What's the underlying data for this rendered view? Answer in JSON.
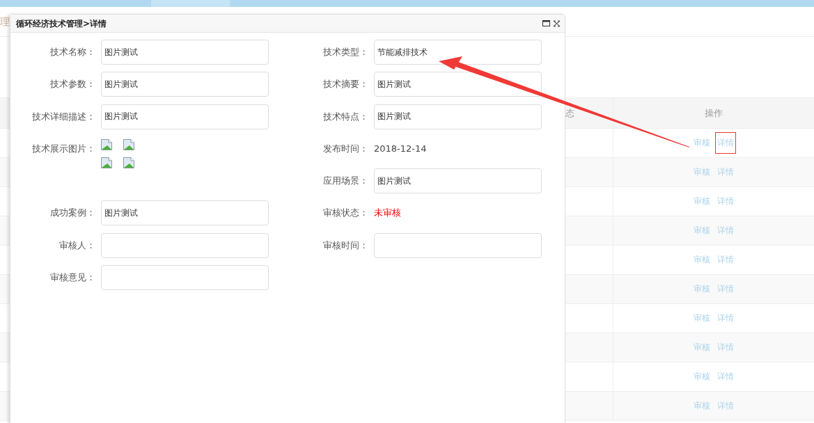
{
  "page": {
    "title_fragment": "理"
  },
  "table": {
    "columns": [
      "态",
      "操作"
    ],
    "rows": [
      {
        "actions": [
          {
            "label": "审核",
            "marked": false
          },
          {
            "label": "详情",
            "marked": true
          }
        ]
      },
      {
        "actions": [
          {
            "label": "审核",
            "marked": false
          },
          {
            "label": "详情",
            "marked": false
          }
        ]
      },
      {
        "actions": [
          {
            "label": "审核",
            "marked": false
          },
          {
            "label": "详情",
            "marked": false
          }
        ]
      },
      {
        "actions": [
          {
            "label": "审核",
            "marked": false
          },
          {
            "label": "详情",
            "marked": false
          }
        ]
      },
      {
        "actions": [
          {
            "label": "审核",
            "marked": false
          },
          {
            "label": "详情",
            "marked": false
          }
        ]
      },
      {
        "actions": [
          {
            "label": "审核",
            "marked": false
          },
          {
            "label": "详情",
            "marked": false
          }
        ]
      },
      {
        "actions": [
          {
            "label": "审核",
            "marked": false
          },
          {
            "label": "详情",
            "marked": false
          }
        ]
      },
      {
        "actions": [
          {
            "label": "审核",
            "marked": false
          },
          {
            "label": "详情",
            "marked": false
          }
        ]
      },
      {
        "actions": [
          {
            "label": "审核",
            "marked": false
          },
          {
            "label": "详情",
            "marked": false
          }
        ]
      },
      {
        "actions": [
          {
            "label": "审核",
            "marked": false
          },
          {
            "label": "详情",
            "marked": false
          }
        ]
      }
    ]
  },
  "dialog": {
    "title": "循环经济技术管理>详情",
    "left_fields": [
      {
        "kind": "input",
        "label": "技术名称：",
        "value": "图片测试"
      },
      {
        "kind": "input",
        "label": "技术参数：",
        "value": "图片测试"
      },
      {
        "kind": "input",
        "label": "技术详细描述：",
        "value": "图片测试"
      },
      {
        "kind": "images",
        "label": "技术展示图片："
      },
      {
        "kind": "input",
        "label": "成功案例：",
        "value": "图片测试"
      },
      {
        "kind": "input",
        "label": "审核人："
      },
      {
        "kind": "input",
        "label": "审核意见："
      }
    ],
    "right_fields": [
      {
        "kind": "input",
        "label": "技术类型：",
        "value": "节能减排技术"
      },
      {
        "kind": "input",
        "label": "技术摘要：",
        "value": "图片测试"
      },
      {
        "kind": "input",
        "label": "技术特点：",
        "value": "图片测试"
      },
      {
        "kind": "text",
        "label": "发布时间：",
        "value": "2018-12-14"
      },
      {
        "kind": "input",
        "label": "应用场景：",
        "value": "图片测试"
      },
      {
        "kind": "status",
        "label": "审核状态：",
        "value": "未审核"
      },
      {
        "kind": "input",
        "label": "审核时间："
      }
    ]
  }
}
